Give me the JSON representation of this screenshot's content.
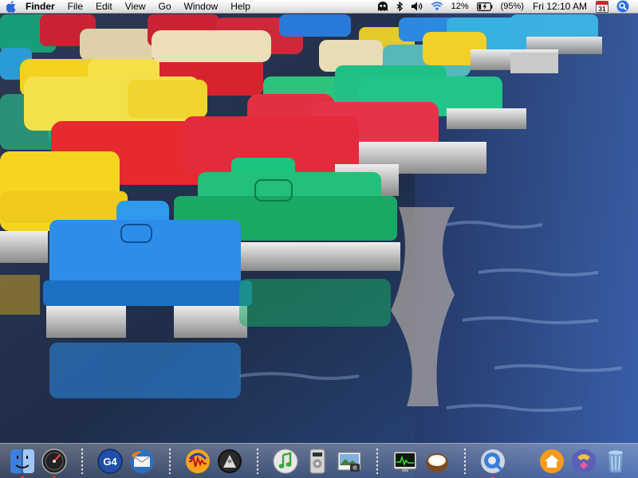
{
  "menubar": {
    "apple_icon": "apple-icon",
    "app_name": "Finder",
    "menus": [
      "File",
      "Edit",
      "View",
      "Go",
      "Window",
      "Help"
    ],
    "extras": {
      "battery_percent": "12%",
      "battery_charge": "(95%)",
      "clock": "Fri 12:10 AM",
      "calendar_day": "31"
    }
  },
  "dock": {
    "g4_label": "G4",
    "icons": [
      "finder-icon",
      "dashboard-icon",
      "g4-icon",
      "thunderbird-icon",
      "audacity-icon",
      "vlc-icon",
      "itunes-icon",
      "dvd-player-icon",
      "iphoto-icon",
      "activity-monitor-icon",
      "coconut-battery-icon",
      "quicktime-icon",
      "home-icon",
      "bittorrent-icon",
      "trash-icon"
    ]
  },
  "colors": {
    "water": "#233048",
    "boat_blue": "#2c8ee8",
    "boat_green": "#22c07a",
    "boat_red": "#e0293a",
    "boat_yellow": "#f0cc2c"
  }
}
